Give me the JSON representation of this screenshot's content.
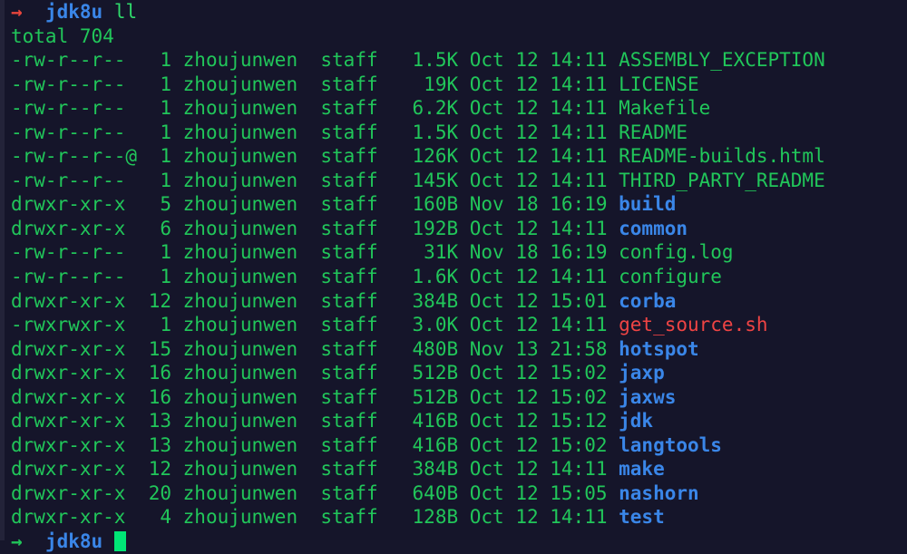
{
  "terminal": {
    "background": "#15152a",
    "edge_color": "#232339",
    "colors": {
      "output_green": "#21c65a",
      "directory_blue": "#3a86e8",
      "executable_red": "#ef4444",
      "prompt_error_red": "#e8453c",
      "prompt_ok_green": "#21c65a",
      "cursor_green": "#00e676"
    }
  },
  "prompt_top": {
    "symbol": "→",
    "cwd": "jdk8u",
    "command": "ll"
  },
  "total_line": "total 704",
  "listing": {
    "columns": [
      "permissions",
      "links",
      "owner",
      "group",
      "size",
      "month",
      "day",
      "time",
      "name"
    ],
    "rows": [
      {
        "permissions": "-rw-r--r--",
        "links": "1",
        "owner": "zhoujunwen",
        "group": "staff",
        "size": "1.5K",
        "month": "Oct",
        "day": "12",
        "time": "14:11",
        "name": "ASSEMBLY_EXCEPTION",
        "type": "file"
      },
      {
        "permissions": "-rw-r--r--",
        "links": "1",
        "owner": "zhoujunwen",
        "group": "staff",
        "size": "19K",
        "month": "Oct",
        "day": "12",
        "time": "14:11",
        "name": "LICENSE",
        "type": "file"
      },
      {
        "permissions": "-rw-r--r--",
        "links": "1",
        "owner": "zhoujunwen",
        "group": "staff",
        "size": "6.2K",
        "month": "Oct",
        "day": "12",
        "time": "14:11",
        "name": "Makefile",
        "type": "file"
      },
      {
        "permissions": "-rw-r--r--",
        "links": "1",
        "owner": "zhoujunwen",
        "group": "staff",
        "size": "1.5K",
        "month": "Oct",
        "day": "12",
        "time": "14:11",
        "name": "README",
        "type": "file"
      },
      {
        "permissions": "-rw-r--r--@",
        "links": "1",
        "owner": "zhoujunwen",
        "group": "staff",
        "size": "126K",
        "month": "Oct",
        "day": "12",
        "time": "14:11",
        "name": "README-builds.html",
        "type": "file"
      },
      {
        "permissions": "-rw-r--r--",
        "links": "1",
        "owner": "zhoujunwen",
        "group": "staff",
        "size": "145K",
        "month": "Oct",
        "day": "12",
        "time": "14:11",
        "name": "THIRD_PARTY_README",
        "type": "file"
      },
      {
        "permissions": "drwxr-xr-x",
        "links": "5",
        "owner": "zhoujunwen",
        "group": "staff",
        "size": "160B",
        "month": "Nov",
        "day": "18",
        "time": "16:19",
        "name": "build",
        "type": "dir"
      },
      {
        "permissions": "drwxr-xr-x",
        "links": "6",
        "owner": "zhoujunwen",
        "group": "staff",
        "size": "192B",
        "month": "Oct",
        "day": "12",
        "time": "14:11",
        "name": "common",
        "type": "dir"
      },
      {
        "permissions": "-rw-r--r--",
        "links": "1",
        "owner": "zhoujunwen",
        "group": "staff",
        "size": "31K",
        "month": "Nov",
        "day": "18",
        "time": "16:19",
        "name": "config.log",
        "type": "file"
      },
      {
        "permissions": "-rw-r--r--",
        "links": "1",
        "owner": "zhoujunwen",
        "group": "staff",
        "size": "1.6K",
        "month": "Oct",
        "day": "12",
        "time": "14:11",
        "name": "configure",
        "type": "file"
      },
      {
        "permissions": "drwxr-xr-x",
        "links": "12",
        "owner": "zhoujunwen",
        "group": "staff",
        "size": "384B",
        "month": "Oct",
        "day": "12",
        "time": "15:01",
        "name": "corba",
        "type": "dir"
      },
      {
        "permissions": "-rwxrwxr-x",
        "links": "1",
        "owner": "zhoujunwen",
        "group": "staff",
        "size": "3.0K",
        "month": "Oct",
        "day": "12",
        "time": "14:11",
        "name": "get_source.sh",
        "type": "exec"
      },
      {
        "permissions": "drwxr-xr-x",
        "links": "15",
        "owner": "zhoujunwen",
        "group": "staff",
        "size": "480B",
        "month": "Nov",
        "day": "13",
        "time": "21:58",
        "name": "hotspot",
        "type": "dir"
      },
      {
        "permissions": "drwxr-xr-x",
        "links": "16",
        "owner": "zhoujunwen",
        "group": "staff",
        "size": "512B",
        "month": "Oct",
        "day": "12",
        "time": "15:02",
        "name": "jaxp",
        "type": "dir"
      },
      {
        "permissions": "drwxr-xr-x",
        "links": "16",
        "owner": "zhoujunwen",
        "group": "staff",
        "size": "512B",
        "month": "Oct",
        "day": "12",
        "time": "15:02",
        "name": "jaxws",
        "type": "dir"
      },
      {
        "permissions": "drwxr-xr-x",
        "links": "13",
        "owner": "zhoujunwen",
        "group": "staff",
        "size": "416B",
        "month": "Oct",
        "day": "12",
        "time": "15:12",
        "name": "jdk",
        "type": "dir"
      },
      {
        "permissions": "drwxr-xr-x",
        "links": "13",
        "owner": "zhoujunwen",
        "group": "staff",
        "size": "416B",
        "month": "Oct",
        "day": "12",
        "time": "15:02",
        "name": "langtools",
        "type": "dir"
      },
      {
        "permissions": "drwxr-xr-x",
        "links": "12",
        "owner": "zhoujunwen",
        "group": "staff",
        "size": "384B",
        "month": "Oct",
        "day": "12",
        "time": "14:11",
        "name": "make",
        "type": "dir"
      },
      {
        "permissions": "drwxr-xr-x",
        "links": "20",
        "owner": "zhoujunwen",
        "group": "staff",
        "size": "640B",
        "month": "Oct",
        "day": "12",
        "time": "15:05",
        "name": "nashorn",
        "type": "dir"
      },
      {
        "permissions": "drwxr-xr-x",
        "links": "4",
        "owner": "zhoujunwen",
        "group": "staff",
        "size": "128B",
        "month": "Oct",
        "day": "12",
        "time": "14:11",
        "name": "test",
        "type": "dir"
      }
    ]
  },
  "prompt_bottom": {
    "symbol": "→",
    "cwd": "jdk8u",
    "command": ""
  }
}
